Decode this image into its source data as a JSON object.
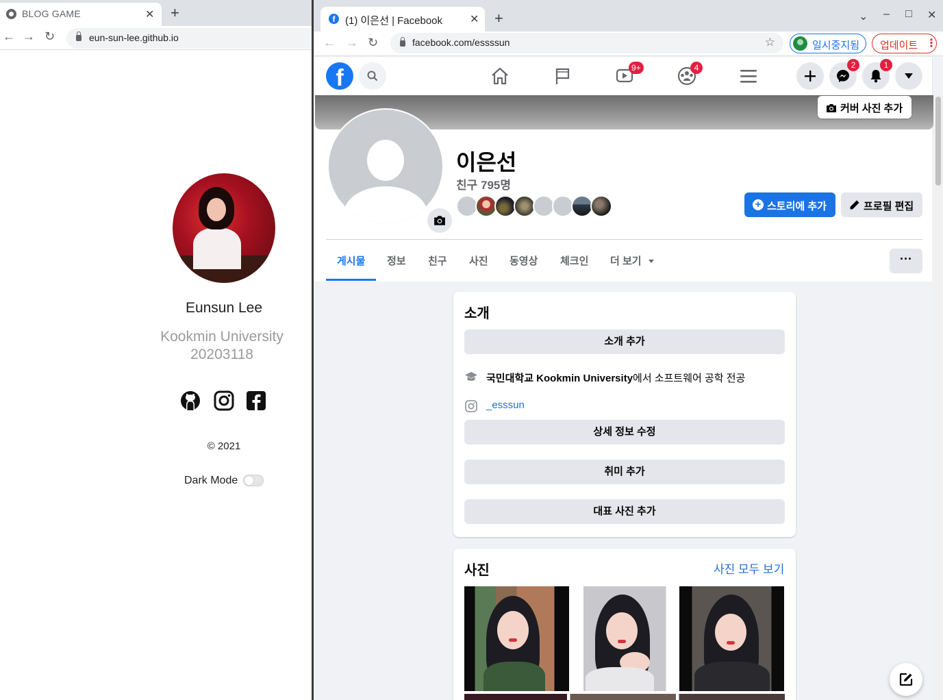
{
  "left_browser": {
    "tab_title": "BLOG GAME",
    "url": "eun-sun-lee.github.io"
  },
  "blog": {
    "name": "Eunsun Lee",
    "school_line1": "Kookmin University",
    "school_line2": "20203118",
    "social_icons": [
      "github-icon",
      "instagram-icon",
      "facebook-icon"
    ],
    "copyright": "© 2021",
    "dark_mode_label": "Dark Mode",
    "dark_mode_on": false
  },
  "right_browser": {
    "tab_title": "(1) 이은선 | Facebook",
    "url": "facebook.com/essssun",
    "profile_chip": "일시중지됨",
    "update_chip": "업데이트"
  },
  "fb_nav": {
    "watch_badge": "9+",
    "groups_badge": "4",
    "messenger_badge": "2",
    "notifications_badge": "1"
  },
  "profile": {
    "cover_button": "커버 사진 추가",
    "name": "이은선",
    "friend_count": "친구 795명",
    "add_story": "스토리에 추가",
    "edit_profile": "프로필 편집",
    "tabs": [
      "게시물",
      "정보",
      "친구",
      "사진",
      "동영상",
      "체크인",
      "더 보기"
    ],
    "active_tab": "게시물",
    "more_dots": "···"
  },
  "intro": {
    "title": "소개",
    "add_bio": "소개 추가",
    "education_school": "국민대학교 Kookmin University",
    "education_rest": "에서 소프트웨어 공학 전공",
    "instagram": "_esssun",
    "edit_details": "상세 정보 수정",
    "add_hobbies": "취미 추가",
    "add_featured": "대표 사진 추가"
  },
  "photos": {
    "title": "사진",
    "see_all": "사진 모두 보기"
  },
  "colors": {
    "fb_blue": "#1877f2",
    "badge_red": "#e41e3f",
    "link_blue": "#216fdb"
  }
}
